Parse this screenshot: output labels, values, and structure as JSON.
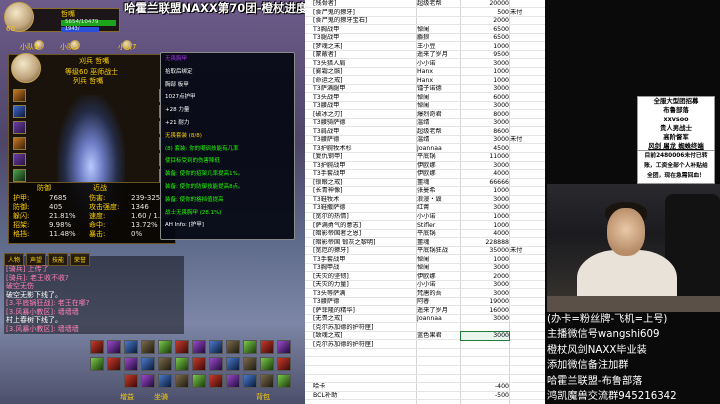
{
  "overlay": {
    "title": "哈霍兰联盟NAXX第70团-橙杖进度40\\40片。只差头端和末端"
  },
  "game": {
    "player_frame": {
      "name": "哲嘴",
      "hp": "5654/10479",
      "mp": "1943/",
      "level": "60"
    },
    "party": [
      "小队1",
      "小队3",
      "小队7"
    ],
    "target_name": "刈兵 哲嘴",
    "char_title": "等级60 巫师战士",
    "inspect_label": "列兵 哲嘴",
    "stats_tabs": [
      "防御",
      "近战"
    ],
    "stats": [
      {
        "label": "护甲:",
        "value": "7685"
      },
      {
        "label": "防御:",
        "value": "405"
      },
      {
        "label": "躲闪:",
        "value": "21.81%"
      },
      {
        "label": "招架:",
        "value": "9.98%"
      },
      {
        "label": "格挡:",
        "value": "11.48%"
      }
    ],
    "melee": [
      {
        "label": "伤害:",
        "value": "239-325"
      },
      {
        "label": "攻击强度:",
        "value": "1346"
      },
      {
        "label": "速度:",
        "value": "1.60 / 1.50"
      },
      {
        "label": "命中:",
        "value": "13.72%"
      },
      {
        "label": "暴击:",
        "value": "0%"
      }
    ],
    "tooltip": [
      {
        "t": "无畏胸甲",
        "c": "p"
      },
      {
        "t": "拾取后绑定",
        "c": "w"
      },
      {
        "t": "胸部  板甲",
        "c": "w"
      },
      {
        "t": "1027点护甲",
        "c": "w"
      },
      {
        "t": "+28 力量",
        "c": "w"
      },
      {
        "t": "+21 耐力",
        "c": "w"
      },
      {
        "t": "无畏套装 (8/8)",
        "c": "y"
      },
      {
        "t": "(8) 套装: 你的嘲讽技能有几率",
        "c": "g"
      },
      {
        "t": "使目标受到的伤害降低",
        "c": "g"
      },
      {
        "t": "装备: 使你的招架几率提高1%。",
        "c": "g"
      },
      {
        "t": "装备: 使你的防御技能提高8点。",
        "c": "g"
      },
      {
        "t": "装备: 使你的格挡值提高",
        "c": "g"
      },
      {
        "t": "战士无畏胸甲 (28.1%)",
        "c": "g"
      },
      {
        "t": "AH Info: [护甲]",
        "c": "w"
      }
    ],
    "chat_tabs": [
      "人物",
      "声望",
      "技能",
      "荣誉"
    ],
    "chat": [
      {
        "t": "[骑兵] 上传了",
        "c": "pink"
      },
      {
        "t": "[骑兵]: 老王收不收?",
        "c": "pink"
      },
      {
        "t": "破空无伤",
        "c": "pink"
      },
      {
        "t": "破空无影下线了。",
        "c": "w"
      },
      {
        "t": "[3.平底锅狂战]: 老王在哪?",
        "c": "pink"
      },
      {
        "t": "[3.风暴小教区]: 墙墙墙",
        "c": "pink"
      },
      {
        "t": "村上春树下线了。",
        "c": "w"
      },
      {
        "t": "[3.风暴小教区]: 墙墙墙",
        "c": "pink"
      }
    ],
    "action_labels": [
      "增益",
      "坐骑",
      "背包"
    ]
  },
  "sheet": {
    "rows": [
      {
        "item": "[残骨者]",
        "name": "超级老帮",
        "amt": "20000",
        "note": ""
      },
      {
        "item": "[食尸鬼的獠牙]",
        "name": "",
        "amt": "500",
        "note": "未付"
      },
      {
        "item": "[食尸鬼的獠牙宝石]",
        "name": "",
        "amt": "2000",
        "note": ""
      },
      {
        "item": "T3胸战甲",
        "name": "悼阑",
        "amt": "6500",
        "note": ""
      },
      {
        "item": "T3腿战甲",
        "name": "麝狼",
        "amt": "6500",
        "note": ""
      },
      {
        "item": "[梦魂之末]",
        "name": "王小豆",
        "amt": "1000",
        "note": ""
      },
      {
        "item": "[蒙蔽者]",
        "name": "遥来了岁月",
        "amt": "9500",
        "note": ""
      },
      {
        "item": "T3头猎人肩",
        "name": "小小诺",
        "amt": "3000",
        "note": ""
      },
      {
        "item": "[雾霜之骸]",
        "name": "Hanx",
        "amt": "1000",
        "note": ""
      },
      {
        "item": "[命运之戒]",
        "name": "Hanx",
        "amt": "1000",
        "note": ""
      },
      {
        "item": "T3萨满腿甲",
        "name": "镭子诺德",
        "amt": "3000",
        "note": ""
      },
      {
        "item": "T3头战甲",
        "name": "悼阑",
        "amt": "6000",
        "note": ""
      },
      {
        "item": "T3腰战甲",
        "name": "悼阑",
        "amt": "3000",
        "note": ""
      },
      {
        "item": "[破冰之刃]",
        "name": "爆烈奇君",
        "amt": "8000",
        "note": ""
      },
      {
        "item": "T3腰骑萨德",
        "name": "温靖",
        "amt": "3000",
        "note": ""
      },
      {
        "item": "T3肩战甲",
        "name": "超级老帮",
        "amt": "8600",
        "note": ""
      },
      {
        "item": "T3腰萨德",
        "name": "温靖",
        "amt": "3000",
        "note": "未付"
      },
      {
        "item": "T3护腕牧术杉",
        "name": "Joannaa",
        "amt": "4500",
        "note": ""
      },
      {
        "item": "[复仇钢甲]",
        "name": "平底锅",
        "amt": "11000",
        "note": ""
      },
      {
        "item": "T3护腕战甲",
        "name": "伊欧娜",
        "amt": "3000",
        "note": ""
      },
      {
        "item": "T3手套战甲",
        "name": "伊欧娜",
        "amt": "4000",
        "note": ""
      },
      {
        "item": "[锁眼之戒]",
        "name": "噩魂",
        "amt": "66666",
        "note": ""
      },
      {
        "item": "[长青神像]",
        "name": "张曼希",
        "amt": "1000",
        "note": ""
      },
      {
        "item": "T3鞋牧术",
        "name": "浪漫・毁",
        "amt": "3000",
        "note": ""
      },
      {
        "item": "T3鞋撒萨德",
        "name": "红菁",
        "amt": "3000",
        "note": ""
      },
      {
        "item": "[宽尔的热情]",
        "name": "小小诺",
        "amt": "1000",
        "note": ""
      },
      {
        "item": "[萨满勇气的意志]",
        "name": "Stifler",
        "amt": "1000",
        "note": ""
      },
      {
        "item": "[暗影帝国者之恩]",
        "name": "平底锅",
        "amt": "4000",
        "note": ""
      },
      {
        "item": "[暗影帝国 锻灰之黎明]",
        "name": "噩魂",
        "amt": "228888",
        "note": ""
      },
      {
        "item": "[宽厄的獠牙]",
        "name": "平底锅狂战",
        "amt": "35000",
        "note": "未付"
      },
      {
        "item": "T3手套战甲",
        "name": "悼阑",
        "amt": "1000",
        "note": ""
      },
      {
        "item": "T3胸甲战",
        "name": "悼阑",
        "amt": "3000",
        "note": ""
      },
      {
        "item": "[天灾的坚韧]",
        "name": "伊欧娜",
        "amt": "2000",
        "note": ""
      },
      {
        "item": "[天灾的力量]",
        "name": "小小诺",
        "amt": "3000",
        "note": ""
      },
      {
        "item": "T3头等萨满",
        "name": "梵唐的吾",
        "amt": "3000",
        "note": ""
      },
      {
        "item": "T3腰萨德",
        "name": "阿睿",
        "amt": "19000",
        "note": ""
      },
      {
        "item": "[萨菲隆的精华]",
        "name": "遥来了岁月",
        "amt": "16000",
        "note": ""
      },
      {
        "item": "[无畏之戒]",
        "name": "Joannaa",
        "amt": "3000",
        "note": ""
      },
      {
        "item": "[克尔苏加德的护符匣]",
        "name": "",
        "amt": "",
        "note": ""
      },
      {
        "item": "[致魂之戒]",
        "name": "蓝色果君",
        "amt": "3000",
        "note": ""
      },
      {
        "item": "[克尔苏加德的护符匣]",
        "name": "",
        "amt": "",
        "note": ""
      },
      {
        "item": "",
        "name": "",
        "amt": "",
        "note": ""
      },
      {
        "item": "",
        "name": "",
        "amt": "",
        "note": ""
      },
      {
        "item": "",
        "name": "",
        "amt": "",
        "note": ""
      },
      {
        "item": "",
        "name": "",
        "amt": "",
        "note": ""
      },
      {
        "item": "哈卡",
        "name": "",
        "amt": "-400",
        "note": ""
      },
      {
        "item": "BCL补助",
        "name": "",
        "amt": "-500",
        "note": ""
      }
    ]
  },
  "right": {
    "ad_top": [
      "全服大型团招募",
      "布鲁部落",
      "xxvsoo",
      "贵人男战士",
      "高阶督军"
    ],
    "ad_mid": [
      "风剑 屠龙 蜘蛛终端"
    ],
    "ad_bottom": [
      "目前2480006未付已转",
      "账，工资全部个人补贴给",
      "全团，现在急需回血！"
    ],
    "promo": [
      "(办卡=粉丝牌-飞机=上号)",
      "主播微信号wangshi609",
      "橙杖风剑NAXX毕业装",
      "添加微信备注加群",
      "哈霍兰联盟-布鲁部落",
      "鸿凯魔兽交流群945216342"
    ]
  }
}
